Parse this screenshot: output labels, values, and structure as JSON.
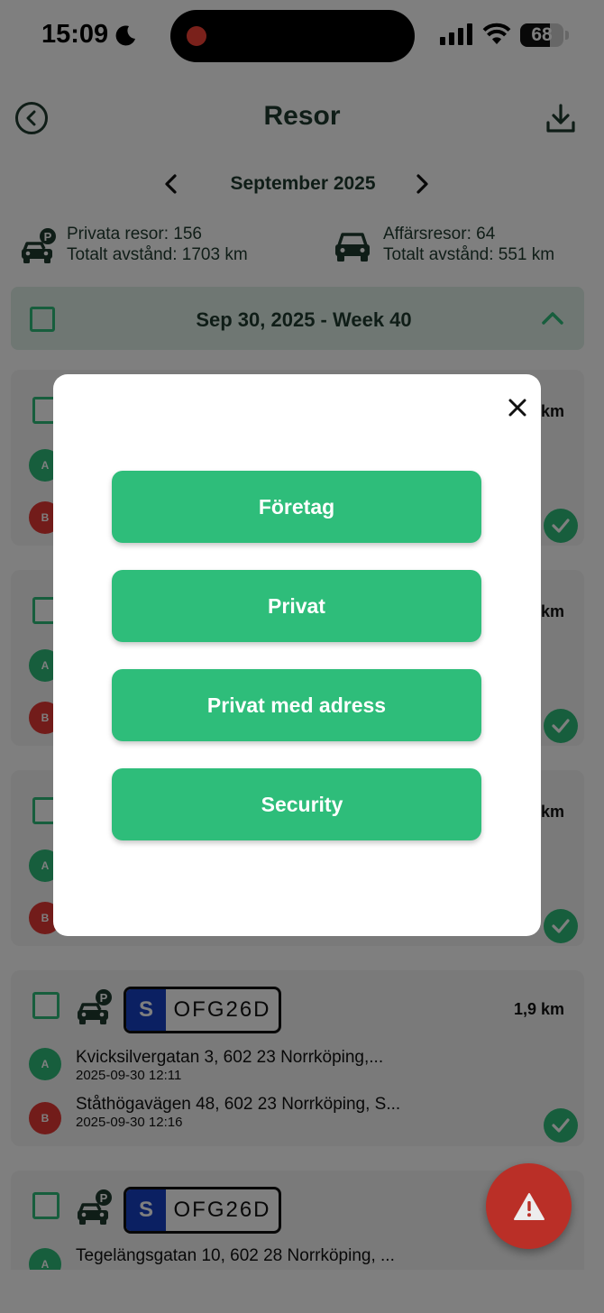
{
  "status_bar": {
    "time": "15:09",
    "battery": "68",
    "battery_level": 0.68
  },
  "header": {
    "title": "Resor"
  },
  "month": {
    "label": "September 2025"
  },
  "summary": {
    "private_trips": "Privata resor: 156",
    "private_distance": "Totalt avstånd: 1703 km",
    "business_trips": "Affärsresor: 64",
    "business_distance": "Totalt avstånd: 551 km"
  },
  "week": {
    "label": "Sep 30, 2025 - Week 40"
  },
  "trips": [
    {
      "distance": "km"
    },
    {
      "distance": "km"
    },
    {
      "distance": "km"
    },
    {
      "plate_country": "S",
      "plate": "OFG26D",
      "distance": "1,9 km",
      "from_pin": "A",
      "from": "Kvicksilvergatan 3, 602 23 Norrköping,...",
      "from_time": "2025-09-30 12:11",
      "to_pin": "B",
      "to": "Ståthögavägen 48, 602 23 Norrköping, S...",
      "to_time": "2025-09-30 12:16"
    },
    {
      "plate_country": "S",
      "plate": "OFG26D",
      "from_pin": "A",
      "from": "Tegelängsgatan 10, 602 28 Norrköping, ..."
    }
  ],
  "pins": {
    "a": "A",
    "b": "B"
  },
  "modal": {
    "buttons": [
      "Företag",
      "Privat",
      "Privat med adress",
      "Security"
    ]
  },
  "colors": {
    "primary_green": "#2ebd7a",
    "danger_red": "#c8322a",
    "text_dark": "#1f3a2f"
  },
  "icons": {
    "back": "chevron-left-circle-icon",
    "download": "download-icon",
    "private_car": "car-parking-icon",
    "business_car": "car-icon",
    "alert": "warning-triangle-icon",
    "close": "close-icon"
  }
}
